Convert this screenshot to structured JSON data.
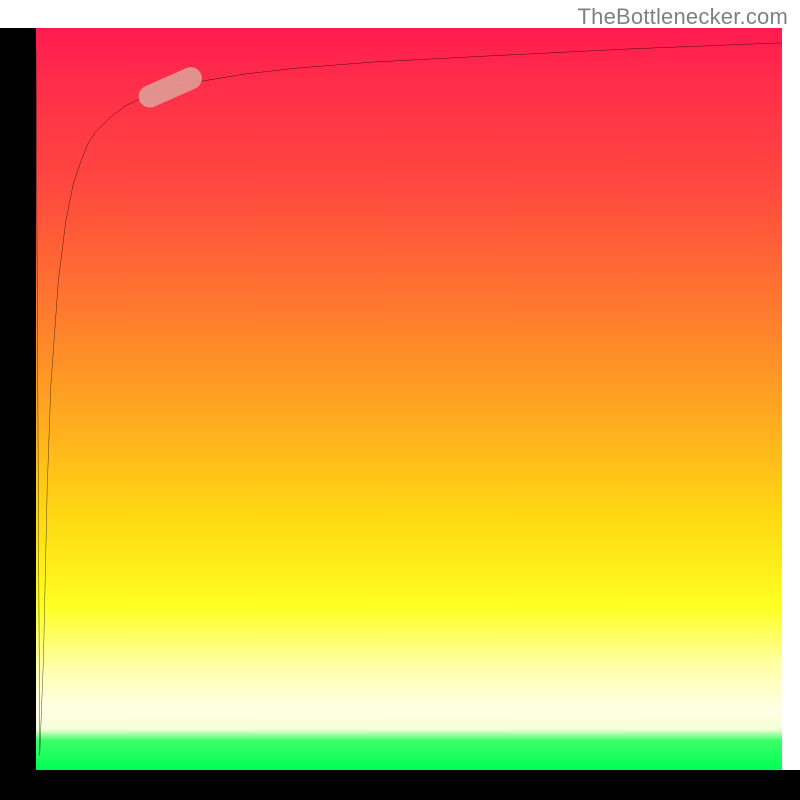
{
  "watermark": "TheBottlenecker.com",
  "chart_data": {
    "type": "line",
    "title": "",
    "xlabel": "",
    "ylabel": "",
    "xlim": [
      0,
      100
    ],
    "ylim": [
      0,
      100
    ],
    "grid": false,
    "background_gradient": {
      "direction": "top-to-bottom",
      "stops": [
        {
          "pos": 0,
          "color": "#ff1a4f"
        },
        {
          "pos": 22,
          "color": "#ff4a3e"
        },
        {
          "pos": 52,
          "color": "#ffa820"
        },
        {
          "pos": 78,
          "color": "#ffff22"
        },
        {
          "pos": 94,
          "color": "#f6ffd8"
        },
        {
          "pos": 100,
          "color": "#00ff55"
        }
      ]
    },
    "series": [
      {
        "name": "bottleneck-curve",
        "color": "#000000",
        "x": [
          0.0,
          0.5,
          1.0,
          1.5,
          2.0,
          3.0,
          4.0,
          5.0,
          6.0,
          7.0,
          8.0,
          10.0,
          12.0,
          15.0,
          18.0,
          22.0,
          28.0,
          35.0,
          45.0,
          60.0,
          80.0,
          100.0
        ],
        "y": [
          97.0,
          2.0,
          15.0,
          38.0,
          52.0,
          66.0,
          74.0,
          79.0,
          82.0,
          84.5,
          86.0,
          88.0,
          89.5,
          91.0,
          92.0,
          92.8,
          93.8,
          94.6,
          95.4,
          96.2,
          97.2,
          98.0
        ]
      }
    ],
    "marker": {
      "name": "highlight-segment",
      "color": "#e19a94",
      "center_x": 18,
      "center_y": 92,
      "length": 9,
      "width": 3,
      "angle_deg": 24
    },
    "axes": {
      "left_bar_color": "#000000",
      "bottom_bar_color": "#000000",
      "ticks": []
    }
  }
}
